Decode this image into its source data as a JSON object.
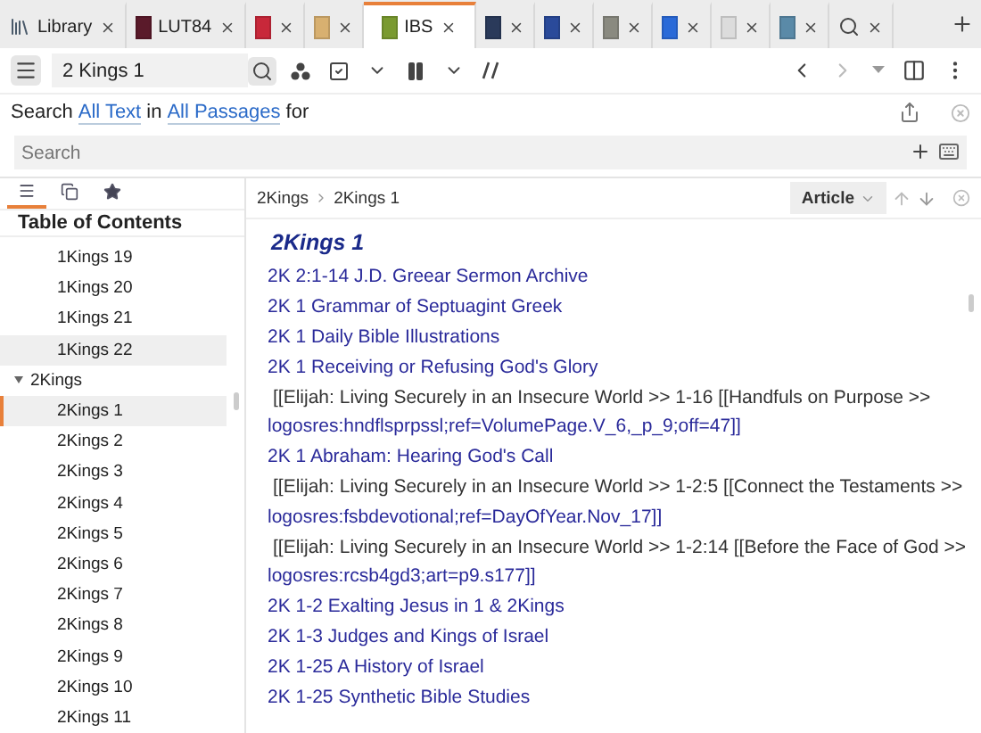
{
  "tabs": [
    {
      "kind": "library",
      "label": "Library",
      "color": "#4a5a6a",
      "selected": false
    },
    {
      "kind": "book",
      "label": "LUT84",
      "color": "#5a1a2a",
      "selected": false
    },
    {
      "kind": "book",
      "color": "#c8283a",
      "selected": false
    },
    {
      "kind": "book",
      "color": "#d8b070",
      "selected": false
    },
    {
      "kind": "book",
      "label": "IBS",
      "color": "#7a9a30",
      "selected": true
    },
    {
      "kind": "book",
      "color": "#2a3a5a",
      "selected": false
    },
    {
      "kind": "book",
      "color": "#2a4a9a",
      "selected": false
    },
    {
      "kind": "book",
      "color": "#8a8a80",
      "selected": false
    },
    {
      "kind": "book",
      "color": "#2a6ad8",
      "selected": false
    },
    {
      "kind": "book",
      "color": "#dcdcdc",
      "selected": false
    },
    {
      "kind": "book",
      "color": "#5a8aa8",
      "selected": false
    },
    {
      "kind": "search",
      "selected": false
    }
  ],
  "toolbar": {
    "reference": "2 Kings 1"
  },
  "search": {
    "prefix": "Search",
    "scope": "All Text",
    "joiner": "in",
    "range": "All Passages",
    "suffix": "for",
    "placeholder": "Search"
  },
  "sidebar": {
    "tabs": [
      {
        "kind": "contents",
        "selected": true
      },
      {
        "kind": "pages",
        "selected": false
      },
      {
        "kind": "favorites",
        "selected": false
      }
    ],
    "title": "Table of Contents",
    "items": [
      {
        "label": "1Kings 19",
        "selected": false,
        "hover": false
      },
      {
        "label": "1Kings 20",
        "selected": false,
        "hover": false
      },
      {
        "label": "1Kings 21",
        "selected": false,
        "hover": false
      },
      {
        "label": "1Kings 22",
        "selected": false,
        "hover": true
      },
      {
        "label": "2Kings",
        "expanded": true,
        "selected": false,
        "hover": false,
        "children": [
          {
            "label": "2Kings 1",
            "selected": true,
            "hover": false
          },
          {
            "label": "2Kings 2",
            "selected": false,
            "hover": false
          },
          {
            "label": "2Kings 3",
            "selected": false,
            "hover": false
          },
          {
            "label": "2Kings 4",
            "selected": false,
            "hover": false
          },
          {
            "label": "2Kings 5",
            "selected": false,
            "hover": false
          },
          {
            "label": "2Kings 6",
            "selected": false,
            "hover": false
          },
          {
            "label": "2Kings 7",
            "selected": false,
            "hover": false
          },
          {
            "label": "2Kings 8",
            "selected": false,
            "hover": false
          },
          {
            "label": "2Kings 9",
            "selected": false,
            "hover": false
          },
          {
            "label": "2Kings 10",
            "selected": false,
            "hover": false
          },
          {
            "label": "2Kings 11",
            "selected": false,
            "hover": false
          }
        ]
      }
    ]
  },
  "article": {
    "breadcrumb": [
      "2Kings",
      "2Kings 1"
    ],
    "view": "Article",
    "heading": "2Kings 1",
    "entries": [
      {
        "kind": "link",
        "text": "2K 2:1-14 J.D. Greear Sermon Archive"
      },
      {
        "kind": "link",
        "text": "2K 1 Grammar of Septuagint Greek"
      },
      {
        "kind": "link",
        "text": "2K 1 Daily Bible Illustrations"
      },
      {
        "kind": "link",
        "text": "2K 1 Receiving or Refusing God's Glory"
      },
      {
        "kind": "note",
        "text": "[[Elijah: Living Securely in an Insecure World >> 1-16 [[Handfuls on Purpose >>",
        "ref": "logosres:hndflsprpssl;ref=VolumePage.V_6,_p_9;off=47]]"
      },
      {
        "kind": "link",
        "text": "2K 1 Abraham: Hearing God's Call"
      },
      {
        "kind": "note",
        "text": "[[Elijah: Living Securely in an Insecure World >> 1-2:5 [[Connect the Testaments >>",
        "ref": "logosres:fsbdevotional;ref=DayOfYear.Nov_17]]"
      },
      {
        "kind": "note",
        "text": "[[Elijah: Living Securely in an Insecure World >> 1-2:14 [[Before the Face of God >>",
        "ref": "logosres:rcsb4gd3;art=p9.s177]]"
      },
      {
        "kind": "link",
        "text": "2K 1-2 Exalting Jesus in 1 & 2Kings"
      },
      {
        "kind": "link",
        "text": "2K 1-3 Judges and Kings of Israel"
      },
      {
        "kind": "link",
        "text": "2K 1-25 A History of Israel"
      },
      {
        "kind": "link",
        "text": "2K 1-25 Synthetic Bible Studies"
      }
    ]
  }
}
